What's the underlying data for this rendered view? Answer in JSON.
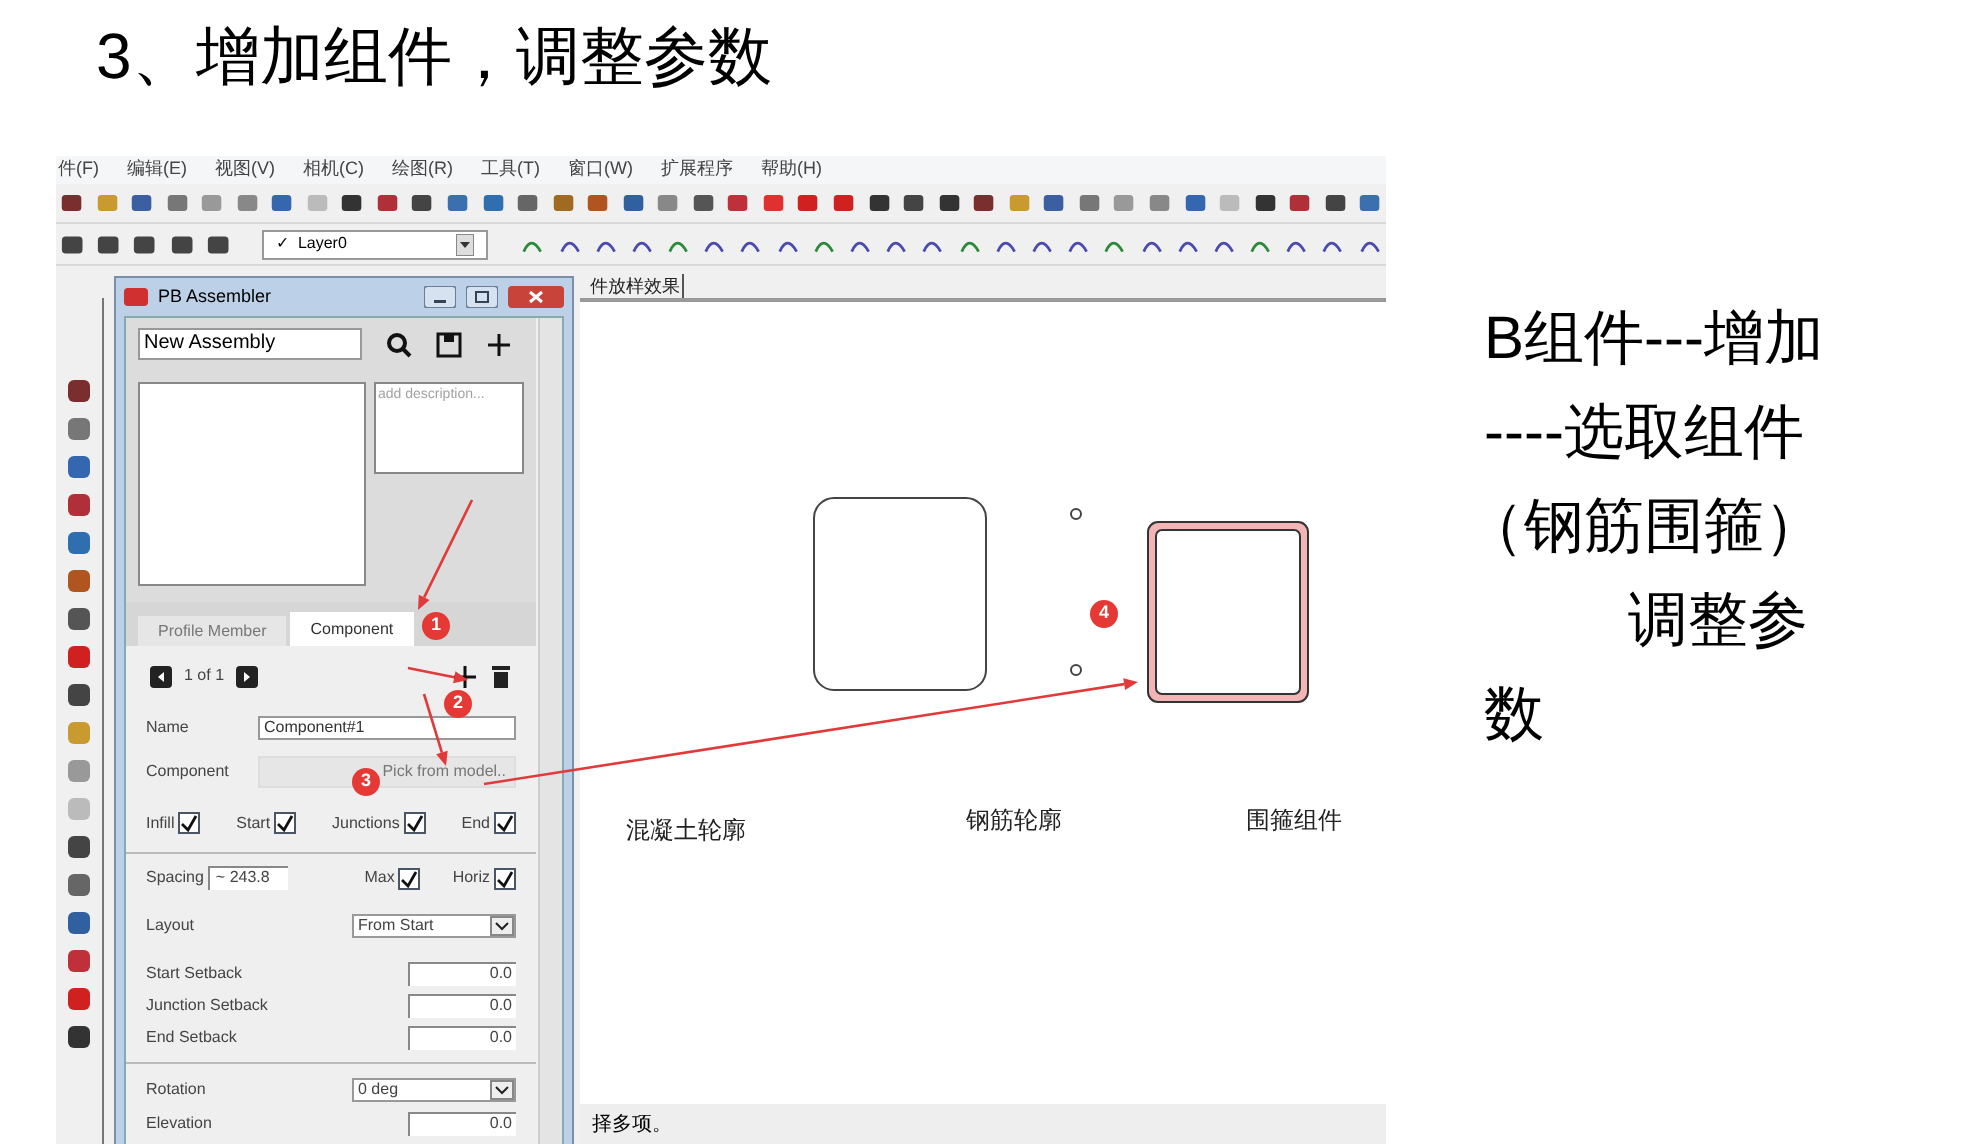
{
  "slide": {
    "title": "3、增加组件，调整参数",
    "note_lines": [
      "B组件---增加",
      "----选取组件",
      "（钢筋围箍）",
      "调整参",
      "数"
    ]
  },
  "app": {
    "menu": [
      "件(F)",
      "编辑(E)",
      "视图(V)",
      "相机(C)",
      "绘图(R)",
      "工具(T)",
      "窗口(W)",
      "扩展程序",
      "帮助(H)"
    ],
    "layer": {
      "check": "✓",
      "value": "Layer0"
    },
    "document_tab": "件放样效果",
    "status_bar": "择多项。",
    "canvas_labels": [
      "混凝土轮廓",
      "钢筋轮廓",
      "围箍组件"
    ]
  },
  "assembler": {
    "title": "PB Assembler",
    "assembly_name": "New Assembly",
    "description_placeholder": "add description...",
    "tabs": [
      {
        "label": "Profile Member",
        "selected": false
      },
      {
        "label": "Component",
        "selected": true
      }
    ],
    "pager": "1 of 1",
    "name_label": "Name",
    "name_value": "Component#1",
    "component_label": "Component",
    "pick_button": "Pick from model..",
    "options": [
      {
        "label": "Infill",
        "checked": true
      },
      {
        "label": "Start",
        "checked": true
      },
      {
        "label": "Junctions",
        "checked": true
      },
      {
        "label": "End",
        "checked": true
      }
    ],
    "spacing_label": "Spacing",
    "spacing_value": "~ 243.8",
    "spacing_options": [
      {
        "label": "Max",
        "checked": true
      },
      {
        "label": "Horiz",
        "checked": true
      }
    ],
    "layout_label": "Layout",
    "layout_value": "From Start",
    "setbacks": [
      {
        "label": "Start Setback",
        "value": "0.0"
      },
      {
        "label": "Junction Setback",
        "value": "0.0"
      },
      {
        "label": "End Setback",
        "value": "0.0"
      }
    ],
    "rotation_label": "Rotation",
    "rotation_value": "0 deg",
    "elevation_label": "Elevation",
    "elevation_value": "0.0"
  },
  "callouts": [
    "1",
    "2",
    "3",
    "4"
  ]
}
